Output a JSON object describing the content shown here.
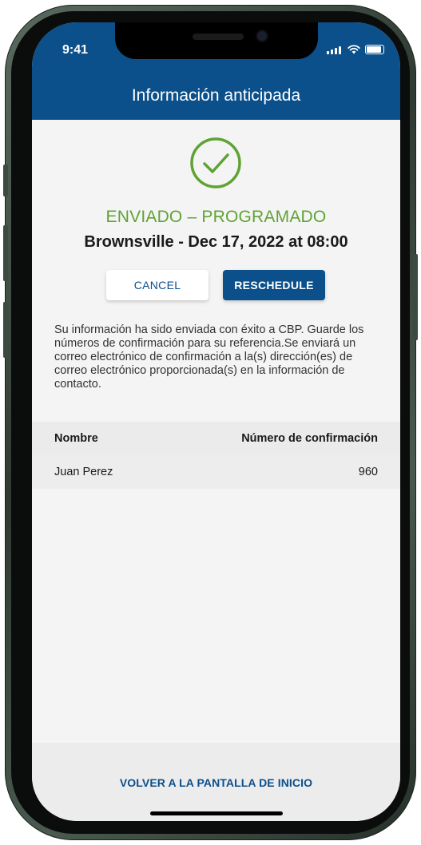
{
  "status_bar": {
    "time": "9:41"
  },
  "header": {
    "title": "Información anticipada"
  },
  "confirmation": {
    "status": "ENVIADO – PROGRAMADO",
    "trip": "Brownsville - Dec 17, 2022 at 08:00",
    "cancel_label": "CANCEL",
    "reschedule_label": "RESCHEDULE",
    "message": "Su información ha sido enviada con éxito a CBP. Guarde los números de confirmación para su referencia.Se enviará un correo electrónico de confirmación a la(s) dirección(es) de correo electrónico proporcionada(s) en la información de contacto."
  },
  "table": {
    "headers": {
      "name": "Nombre",
      "confirmation": "Número de confirmación"
    },
    "rows": [
      {
        "name": "Juan Perez",
        "confirmation": "960"
      }
    ]
  },
  "footer": {
    "home_link": "VOLVER A LA PANTALLA DE INICIO"
  },
  "colors": {
    "brand": "#0b4f8b",
    "success": "#5fa334"
  },
  "icons": {
    "status": "check-circle-icon"
  }
}
